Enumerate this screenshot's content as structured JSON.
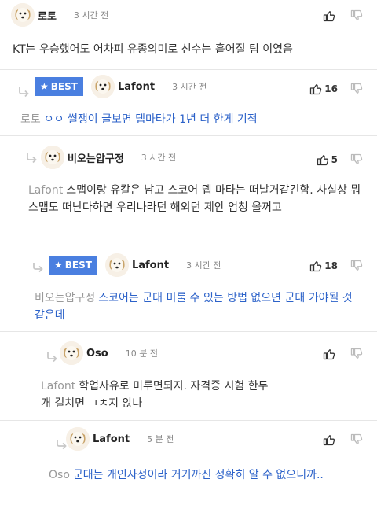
{
  "comments": [
    {
      "user": "로토",
      "time": "3 시간 전",
      "text": "KT는 우승했어도 어차피 유종의미로 선수는 흩어질 팀 이였음",
      "up": "",
      "best": false
    },
    {
      "user": "Lafont",
      "time": "3 시간 전",
      "mention": "로토",
      "text": "ㅇㅇ 썰쟁이 글보면 뎁마타가 1년 더 한게 기적",
      "up": "16",
      "best": true,
      "best_label": "BEST"
    },
    {
      "user": "비오는압구정",
      "time": "3 시간 전",
      "mention": "Lafont",
      "text": "스맵이랑 유칼은 남고 스코어 뎁 마타는 떠날거같긴함. 사실상 뭐 스맵도 떠난다하면 우리나라던 해외던 제안 엄청 올꺼고",
      "up": "5",
      "best": false
    },
    {
      "user": "Lafont",
      "time": "3 시간 전",
      "mention": "비오는압구정",
      "text": "스코어는 군대 미룰 수 있는 방법 없으면 군대 가야될 것 같은데",
      "up": "18",
      "best": true,
      "best_label": "BEST"
    },
    {
      "user": "Oso",
      "time": "10 분 전",
      "mention": "Lafont",
      "text": "학업사유로 미루면되지. 자격증 시험 한두개 걸치면 ㄱㅊ지 않나",
      "up": "",
      "best": false
    },
    {
      "user": "Lafont",
      "time": "5 분 전",
      "mention": "Oso",
      "text": "군대는 개인사정이라 거기까진 정확히 알 수 없으니까..",
      "up": "",
      "best": false
    }
  ],
  "colors": {
    "best_badge": "#4a7fe0",
    "reply_text": "#2c62c9",
    "mention": "#9a9a9a"
  },
  "icons": {
    "upvote": "thumbs-up-icon",
    "downvote": "thumbs-down-icon",
    "reply": "reply-arrow-icon",
    "star": "star-icon",
    "avatar": "puppy-avatar-icon"
  }
}
